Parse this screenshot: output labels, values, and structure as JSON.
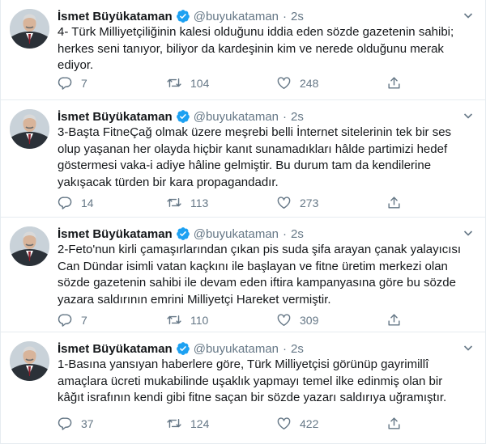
{
  "author": {
    "name": "İsmet Büyükataman",
    "handle": "@buyukataman",
    "separator": "·",
    "time": "2s"
  },
  "icons": {
    "verified": "verified-badge-icon",
    "caret": "chevron-down-icon",
    "reply": "reply-icon",
    "retweet": "retweet-icon",
    "like": "heart-icon",
    "share": "share-icon"
  },
  "colors": {
    "verified": "#1da1f2",
    "muted": "#657786",
    "divider": "#e6ecf0"
  },
  "tweets": [
    {
      "lines": [
        "4- Türk Milliyetçiliğinin kalesi olduğunu iddia eden sözde gazetenin sahibi;",
        "herkes seni tanıyor, biliyor da kardeşinin kim ve nerede olduğunu merak",
        "ediyor."
      ],
      "replies": "7",
      "retweets": "104",
      "likes": "248"
    },
    {
      "lines": [
        "3-Başta FitneÇağ olmak üzere meşrebi belli İnternet sitelerinin tek bir ses",
        "olup yaşanan her olayda hiçbir kanıt sunamadıkları hâlde partimizi hedef",
        "göstermesi vaka-i adiye hâline gelmiştir. Bu durum tam da kendilerine",
        "yakışacak türden bir kara propagandadır."
      ],
      "replies": "14",
      "retweets": "113",
      "likes": "273"
    },
    {
      "lines": [
        "2-Feto'nun kirli çamaşırlarından çıkan pis suda şifa arayan çanak yalayıcısı",
        "Can Dündar isimli vatan kaçkını ile başlayan ve fitne üretim merkezi olan",
        "sözde gazetenin sahibi ile devam eden iftira kampanyasına göre bu sözde",
        "yazara saldırının emrini Milliyetçi Hareket vermiştir."
      ],
      "replies": "7",
      "retweets": "110",
      "likes": "309"
    },
    {
      "lines": [
        "1-Basına yansıyan haberlere göre, Türk Milliyetçisi görünüp gayrimillî",
        "amaçlara ücreti mukabilinde uşaklık yapmayı temel ilke edinmiş olan bir",
        "kâğıt israfının kendi gibi fitne saçan bir sözde yazarı saldırıya uğramıştır."
      ],
      "replies": "37",
      "retweets": "124",
      "likes": "422"
    }
  ]
}
